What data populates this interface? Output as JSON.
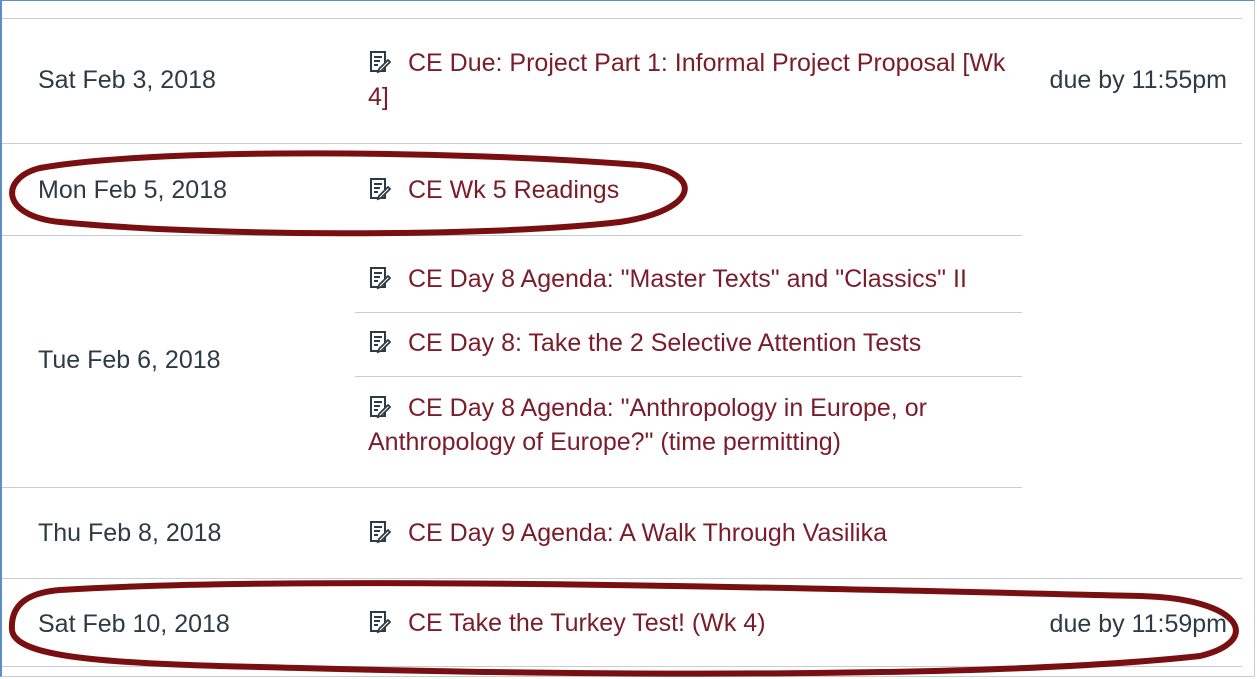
{
  "colors": {
    "link": "#7b1c2a",
    "text": "#2d3b45",
    "divider": "#c7cdd1",
    "annotation": "#7a0f12"
  },
  "rows": [
    {
      "date": "Sat Feb 3, 2018",
      "items": [
        {
          "icon": "assignment-icon",
          "text": "CE Due: Project Part 1: Informal Project Proposal [Wk 4]"
        }
      ],
      "due": "due by 11:55pm"
    },
    {
      "date": "Mon Feb 5, 2018",
      "items": [
        {
          "icon": "assignment-icon",
          "text": "CE Wk 5 Readings"
        }
      ],
      "due": ""
    },
    {
      "date": "Tue Feb 6, 2018",
      "items": [
        {
          "icon": "assignment-icon",
          "text": "CE Day 8 Agenda: \"Master Texts\" and \"Classics\" II"
        },
        {
          "icon": "assignment-icon",
          "text": "CE Day 8: Take the 2 Selective Attention Tests"
        },
        {
          "icon": "assignment-icon",
          "text": "CE Day 8 Agenda: \"Anthropology in Europe, or Anthropology of Europe?\" (time permitting)"
        }
      ],
      "due": ""
    },
    {
      "date": "Thu Feb 8, 2018",
      "items": [
        {
          "icon": "assignment-icon",
          "text": "CE Day 9 Agenda: A Walk Through Vasilika"
        }
      ],
      "due": ""
    },
    {
      "date": "Sat Feb 10, 2018",
      "items": [
        {
          "icon": "assignment-icon",
          "text": "CE Take the Turkey Test! (Wk 4)"
        }
      ],
      "due": "due by 11:59pm"
    }
  ]
}
